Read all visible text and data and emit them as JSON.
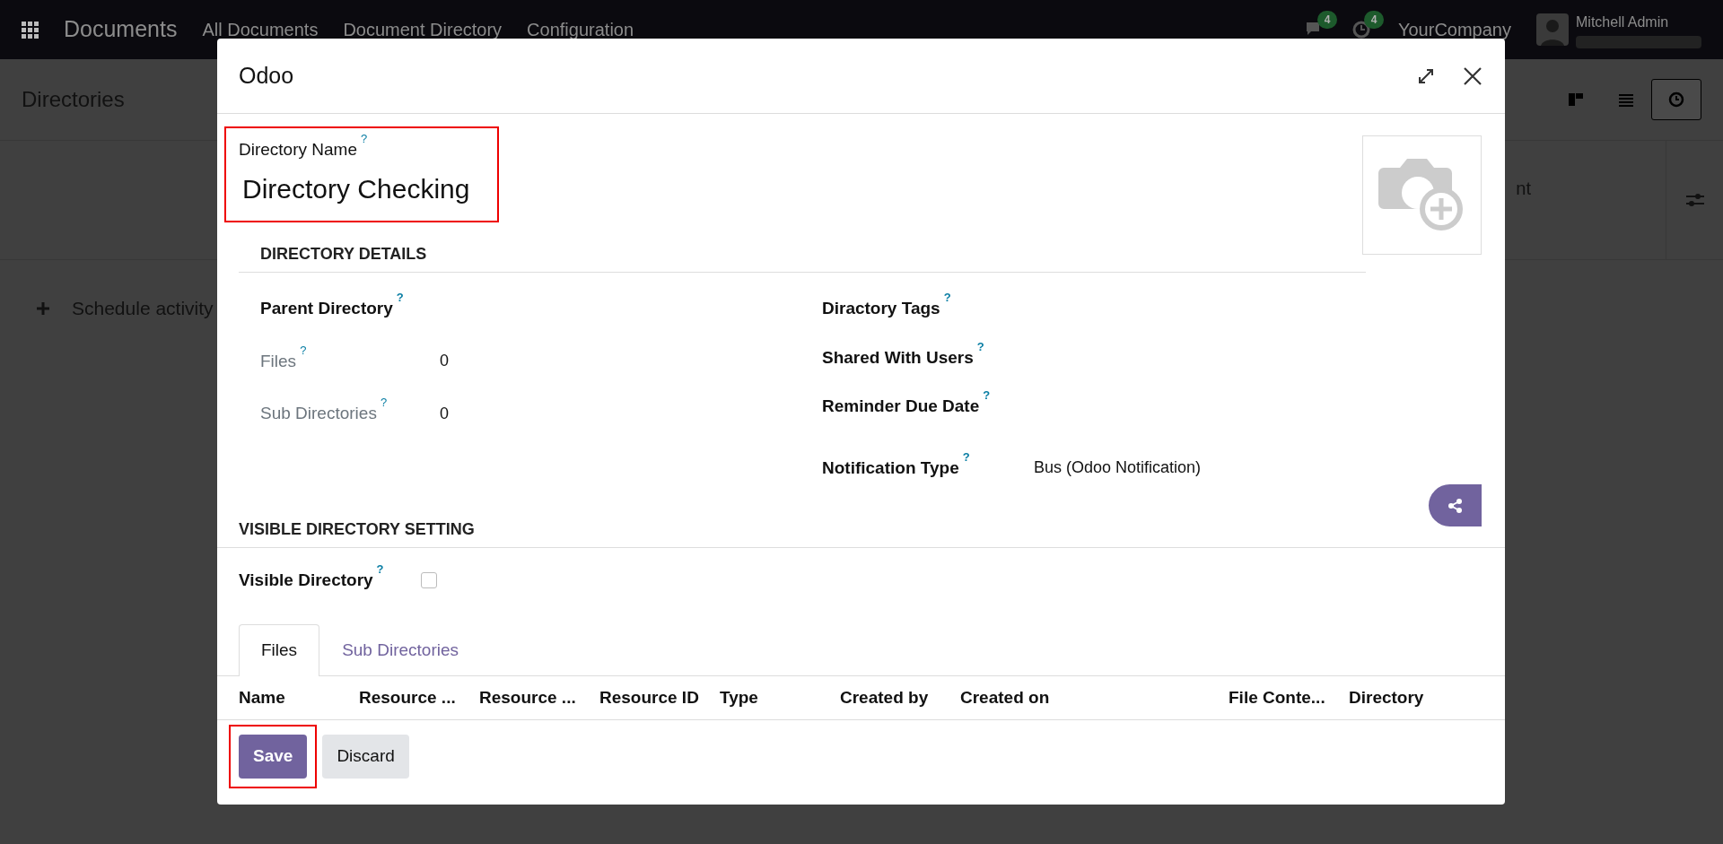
{
  "navbar": {
    "app_name": "Documents",
    "menu": [
      "All Documents",
      "Document Directory",
      "Configuration"
    ],
    "messages_count": "4",
    "activities_count": "4",
    "company": "YourCompany",
    "user": "Mitchell Admin"
  },
  "control_panel": {
    "title": "Directories",
    "views": [
      {
        "kind": "kanban",
        "selected": false
      },
      {
        "kind": "list",
        "selected": false
      },
      {
        "kind": "activity",
        "selected": true
      }
    ]
  },
  "background": {
    "partial_label": "nt",
    "schedule_activity": "Schedule activity"
  },
  "dialog": {
    "title": "Odoo",
    "name_field": {
      "label": "Directory Name",
      "help": "?",
      "value": "Directory Checking",
      "highlighted": true
    },
    "details_section": {
      "title": "DIRECTORY DETAILS",
      "left_fields": [
        {
          "label": "Parent Directory",
          "help": "?",
          "muted": false
        },
        {
          "label": "Files",
          "help": "?",
          "value": "0",
          "muted": true
        },
        {
          "label": "Sub Directories",
          "help": "?",
          "value": "0",
          "muted": true
        }
      ],
      "right_fields": [
        {
          "label": "Diractory Tags",
          "help": "?"
        },
        {
          "label": "Shared With Users",
          "help": "?"
        },
        {
          "label": "Reminder Due Date",
          "help": "?"
        },
        {
          "label": "Notification Type",
          "help": "?",
          "value": "Bus (Odoo Notification)"
        }
      ]
    },
    "visible_section": {
      "title": "VISIBLE DIRECTORY SETTING",
      "field": {
        "label": "Visible Directory",
        "help": "?",
        "checked": false
      }
    },
    "tabs": [
      {
        "label": "Files",
        "selected": true
      },
      {
        "label": "Sub Directories",
        "selected": false
      }
    ],
    "table_columns": [
      "Name",
      "Resource ...",
      "Resource ...",
      "Resource ID",
      "Type",
      "Created by",
      "Created on",
      "File Conte...",
      "Directory"
    ],
    "buttons": [
      {
        "label": "Save",
        "kind": "primary",
        "highlighted": true
      },
      {
        "label": "Discard",
        "kind": "secondary",
        "highlighted": false
      }
    ]
  }
}
